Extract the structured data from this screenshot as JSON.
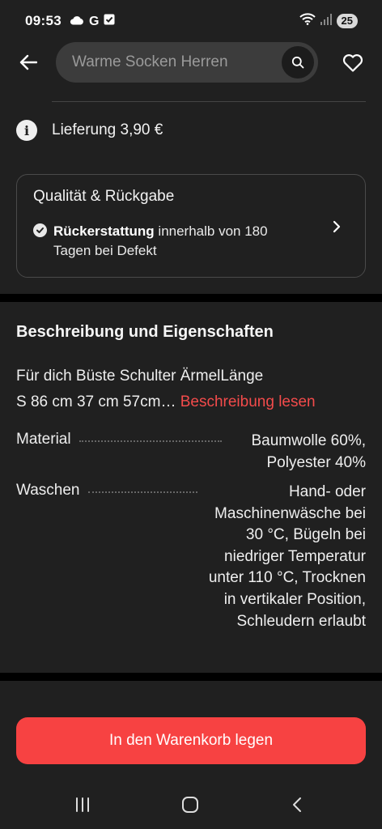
{
  "status_bar": {
    "time": "09:53",
    "carrier_letter": "G",
    "battery": "25"
  },
  "search": {
    "value": "Warme Socken Herren"
  },
  "delivery": {
    "text": "Lieferung 3,90 €"
  },
  "quality": {
    "title": "Qualität & Rückgabe",
    "refund_bold": "Rückerstattung",
    "refund_rest": " innerhalb von 180 Tagen bei Defekt"
  },
  "description": {
    "title": "Beschreibung und Eigenschaften",
    "size_headers": "Für dich  Büste Schulter ÄrmelLänge",
    "size_values": "S 86 cm 37 cm 57cm… ",
    "read_more": "Beschreibung lesen",
    "attributes": [
      {
        "key": "Material",
        "value": "Baumwolle 60%, Polyester 40%"
      },
      {
        "key": "Waschen",
        "value": "Hand- oder Maschinenwäsche bei 30 °C, Bügeln bei niedriger Temperatur unter 110 °C, Trocknen in vertikaler Position, Schleudern erlaubt"
      }
    ]
  },
  "cart_button": {
    "label": "In den Warenkorb legen"
  },
  "colors": {
    "accent": "#f74242",
    "background": "#202020"
  },
  "icons": [
    "cloud-icon",
    "checkbox-icon",
    "wifi-icon",
    "signal-icon",
    "back-arrow-icon",
    "search-icon",
    "heart-icon",
    "info-icon",
    "check-circle-icon",
    "chevron-right-icon",
    "recent-apps-icon",
    "home-icon",
    "nav-back-icon"
  ]
}
